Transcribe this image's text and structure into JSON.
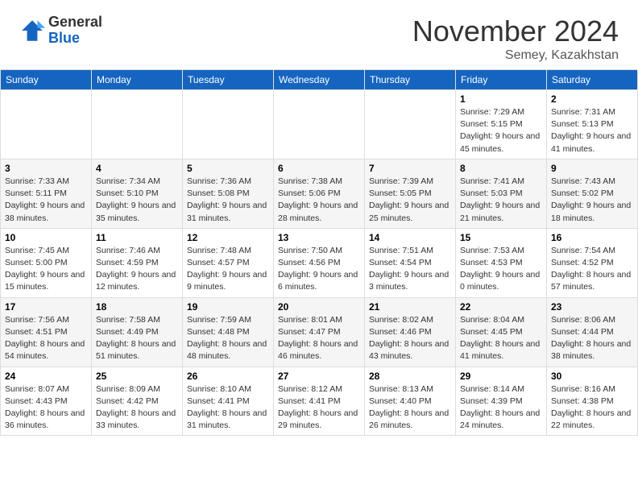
{
  "header": {
    "logo_general": "General",
    "logo_blue": "Blue",
    "month_title": "November 2024",
    "subtitle": "Semey, Kazakhstan"
  },
  "days_of_week": [
    "Sunday",
    "Monday",
    "Tuesday",
    "Wednesday",
    "Thursday",
    "Friday",
    "Saturday"
  ],
  "weeks": [
    {
      "days": [
        {
          "num": "",
          "info": ""
        },
        {
          "num": "",
          "info": ""
        },
        {
          "num": "",
          "info": ""
        },
        {
          "num": "",
          "info": ""
        },
        {
          "num": "",
          "info": ""
        },
        {
          "num": "1",
          "info": "Sunrise: 7:29 AM\nSunset: 5:15 PM\nDaylight: 9 hours and 45 minutes."
        },
        {
          "num": "2",
          "info": "Sunrise: 7:31 AM\nSunset: 5:13 PM\nDaylight: 9 hours and 41 minutes."
        }
      ]
    },
    {
      "days": [
        {
          "num": "3",
          "info": "Sunrise: 7:33 AM\nSunset: 5:11 PM\nDaylight: 9 hours and 38 minutes."
        },
        {
          "num": "4",
          "info": "Sunrise: 7:34 AM\nSunset: 5:10 PM\nDaylight: 9 hours and 35 minutes."
        },
        {
          "num": "5",
          "info": "Sunrise: 7:36 AM\nSunset: 5:08 PM\nDaylight: 9 hours and 31 minutes."
        },
        {
          "num": "6",
          "info": "Sunrise: 7:38 AM\nSunset: 5:06 PM\nDaylight: 9 hours and 28 minutes."
        },
        {
          "num": "7",
          "info": "Sunrise: 7:39 AM\nSunset: 5:05 PM\nDaylight: 9 hours and 25 minutes."
        },
        {
          "num": "8",
          "info": "Sunrise: 7:41 AM\nSunset: 5:03 PM\nDaylight: 9 hours and 21 minutes."
        },
        {
          "num": "9",
          "info": "Sunrise: 7:43 AM\nSunset: 5:02 PM\nDaylight: 9 hours and 18 minutes."
        }
      ]
    },
    {
      "days": [
        {
          "num": "10",
          "info": "Sunrise: 7:45 AM\nSunset: 5:00 PM\nDaylight: 9 hours and 15 minutes."
        },
        {
          "num": "11",
          "info": "Sunrise: 7:46 AM\nSunset: 4:59 PM\nDaylight: 9 hours and 12 minutes."
        },
        {
          "num": "12",
          "info": "Sunrise: 7:48 AM\nSunset: 4:57 PM\nDaylight: 9 hours and 9 minutes."
        },
        {
          "num": "13",
          "info": "Sunrise: 7:50 AM\nSunset: 4:56 PM\nDaylight: 9 hours and 6 minutes."
        },
        {
          "num": "14",
          "info": "Sunrise: 7:51 AM\nSunset: 4:54 PM\nDaylight: 9 hours and 3 minutes."
        },
        {
          "num": "15",
          "info": "Sunrise: 7:53 AM\nSunset: 4:53 PM\nDaylight: 9 hours and 0 minutes."
        },
        {
          "num": "16",
          "info": "Sunrise: 7:54 AM\nSunset: 4:52 PM\nDaylight: 8 hours and 57 minutes."
        }
      ]
    },
    {
      "days": [
        {
          "num": "17",
          "info": "Sunrise: 7:56 AM\nSunset: 4:51 PM\nDaylight: 8 hours and 54 minutes."
        },
        {
          "num": "18",
          "info": "Sunrise: 7:58 AM\nSunset: 4:49 PM\nDaylight: 8 hours and 51 minutes."
        },
        {
          "num": "19",
          "info": "Sunrise: 7:59 AM\nSunset: 4:48 PM\nDaylight: 8 hours and 48 minutes."
        },
        {
          "num": "20",
          "info": "Sunrise: 8:01 AM\nSunset: 4:47 PM\nDaylight: 8 hours and 46 minutes."
        },
        {
          "num": "21",
          "info": "Sunrise: 8:02 AM\nSunset: 4:46 PM\nDaylight: 8 hours and 43 minutes."
        },
        {
          "num": "22",
          "info": "Sunrise: 8:04 AM\nSunset: 4:45 PM\nDaylight: 8 hours and 41 minutes."
        },
        {
          "num": "23",
          "info": "Sunrise: 8:06 AM\nSunset: 4:44 PM\nDaylight: 8 hours and 38 minutes."
        }
      ]
    },
    {
      "days": [
        {
          "num": "24",
          "info": "Sunrise: 8:07 AM\nSunset: 4:43 PM\nDaylight: 8 hours and 36 minutes."
        },
        {
          "num": "25",
          "info": "Sunrise: 8:09 AM\nSunset: 4:42 PM\nDaylight: 8 hours and 33 minutes."
        },
        {
          "num": "26",
          "info": "Sunrise: 8:10 AM\nSunset: 4:41 PM\nDaylight: 8 hours and 31 minutes."
        },
        {
          "num": "27",
          "info": "Sunrise: 8:12 AM\nSunset: 4:41 PM\nDaylight: 8 hours and 29 minutes."
        },
        {
          "num": "28",
          "info": "Sunrise: 8:13 AM\nSunset: 4:40 PM\nDaylight: 8 hours and 26 minutes."
        },
        {
          "num": "29",
          "info": "Sunrise: 8:14 AM\nSunset: 4:39 PM\nDaylight: 8 hours and 24 minutes."
        },
        {
          "num": "30",
          "info": "Sunrise: 8:16 AM\nSunset: 4:38 PM\nDaylight: 8 hours and 22 minutes."
        }
      ]
    }
  ]
}
